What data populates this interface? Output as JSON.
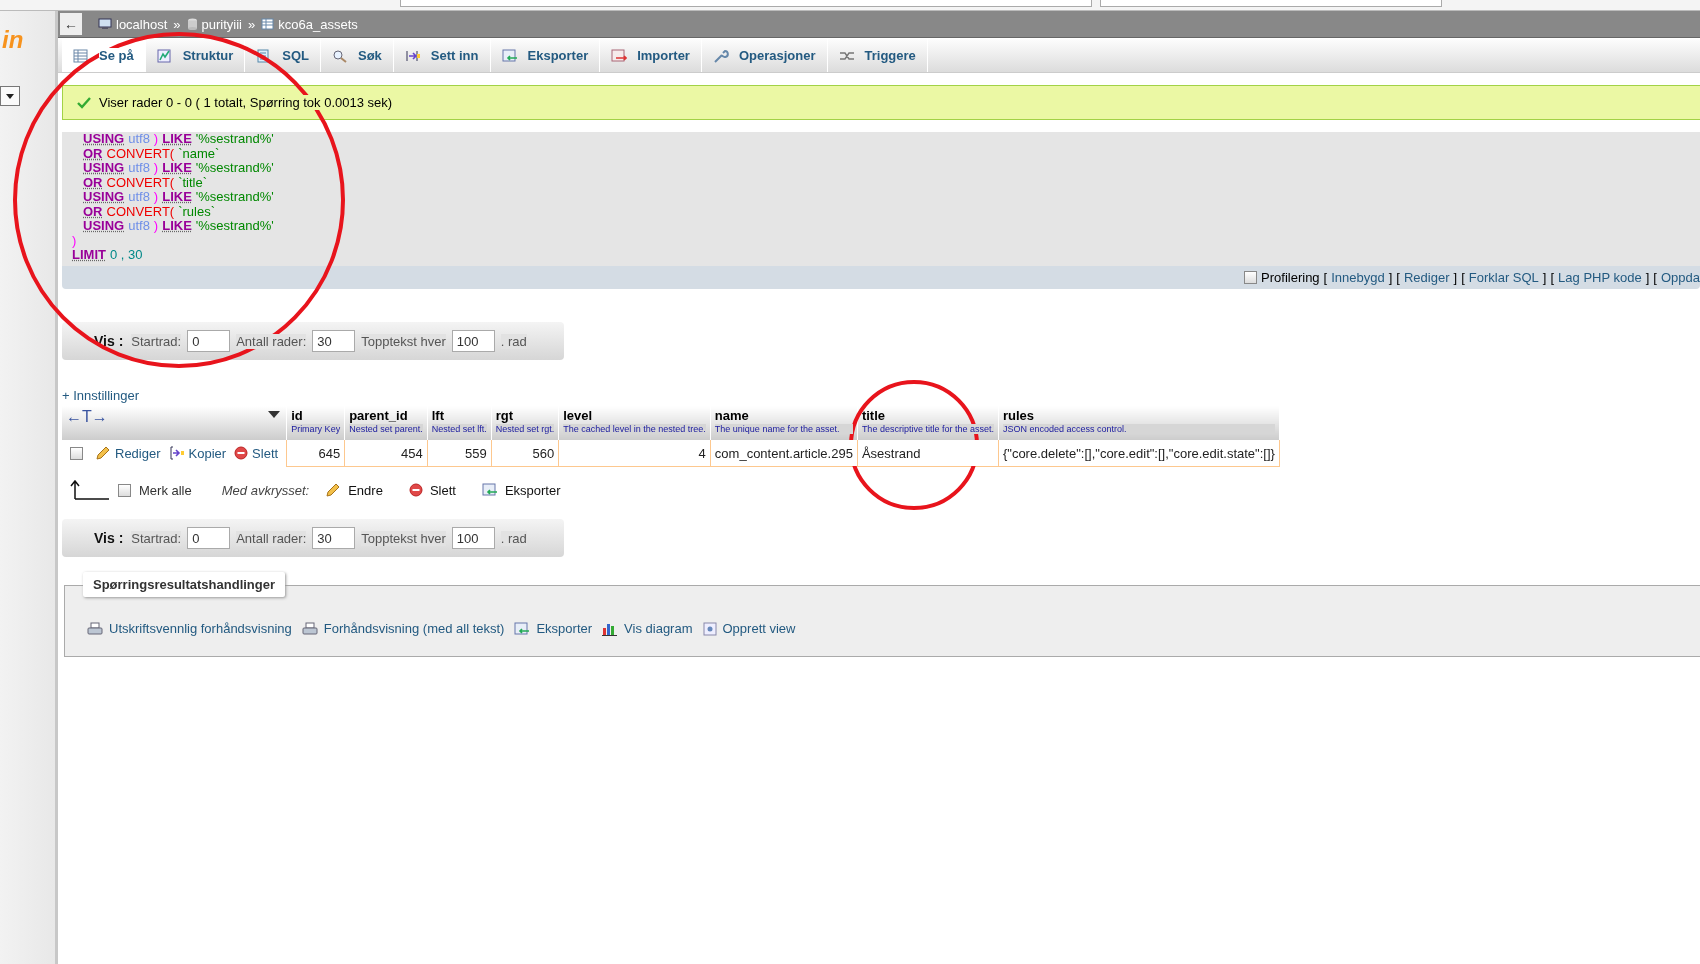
{
  "logo": {
    "text": "in"
  },
  "breadcrumb": [
    {
      "kind": "server",
      "text": "localhost",
      "sep": "»"
    },
    {
      "kind": "database",
      "text": "purityiii",
      "sep": "»"
    },
    {
      "kind": "table",
      "text": "kco6a_assets"
    }
  ],
  "back_button": {
    "text": "←"
  },
  "tabs": [
    {
      "kind": "browse",
      "label": "Se på",
      "selected": true
    },
    {
      "kind": "structure",
      "label": "Struktur",
      "selected": false
    },
    {
      "kind": "sql",
      "label": "SQL",
      "selected": false
    },
    {
      "kind": "search",
      "label": "Søk",
      "selected": false
    },
    {
      "kind": "insert",
      "label": "Sett inn",
      "selected": false
    },
    {
      "kind": "export",
      "label": "Eksporter",
      "selected": false
    },
    {
      "kind": "import",
      "label": "Importer",
      "selected": false
    },
    {
      "kind": "operations",
      "label": "Operasjoner",
      "selected": false
    },
    {
      "kind": "triggers",
      "label": "Triggere",
      "selected": false
    }
  ],
  "message": {
    "text": "Viser rader 0 - 0 ( 1 totalt, Spørring tok 0.0013 sek)"
  },
  "sql_lines": [
    {
      "indent": true,
      "tokens": [
        {
          "kind": "keyword",
          "text": "USING"
        },
        {
          "kind": "charset",
          "text": "utf8"
        },
        {
          "kind": "paren",
          "text": ")"
        },
        {
          "kind": "keyword",
          "text": "LIKE"
        },
        {
          "kind": "string",
          "text": "'%sestrand%'"
        }
      ]
    },
    {
      "indent": true,
      "tokens": [
        {
          "kind": "keyword",
          "text": "OR"
        },
        {
          "kind": "function",
          "text": "CONVERT("
        },
        {
          "kind": "string",
          "text": "`name`"
        }
      ]
    },
    {
      "indent": true,
      "tokens": [
        {
          "kind": "keyword",
          "text": "USING"
        },
        {
          "kind": "charset",
          "text": "utf8"
        },
        {
          "kind": "paren",
          "text": ")"
        },
        {
          "kind": "keyword",
          "text": "LIKE"
        },
        {
          "kind": "string",
          "text": "'%sestrand%'"
        }
      ]
    },
    {
      "indent": true,
      "tokens": [
        {
          "kind": "keyword",
          "text": "OR"
        },
        {
          "kind": "function",
          "text": "CONVERT("
        },
        {
          "kind": "string",
          "text": "`title`"
        }
      ]
    },
    {
      "indent": true,
      "tokens": [
        {
          "kind": "keyword",
          "text": "USING"
        },
        {
          "kind": "charset",
          "text": "utf8"
        },
        {
          "kind": "paren",
          "text": ")"
        },
        {
          "kind": "keyword",
          "text": "LIKE"
        },
        {
          "kind": "string",
          "text": "'%sestrand%'"
        }
      ]
    },
    {
      "indent": true,
      "tokens": [
        {
          "kind": "keyword",
          "text": "OR"
        },
        {
          "kind": "function",
          "text": "CONVERT("
        },
        {
          "kind": "string",
          "text": "`rules`"
        }
      ]
    },
    {
      "indent": true,
      "tokens": [
        {
          "kind": "keyword",
          "text": "USING"
        },
        {
          "kind": "charset",
          "text": "utf8"
        },
        {
          "kind": "paren",
          "text": ")"
        },
        {
          "kind": "keyword",
          "text": "LIKE"
        },
        {
          "kind": "string",
          "text": "'%sestrand%'"
        }
      ]
    },
    {
      "indent": false,
      "tokens": [
        {
          "kind": "paren",
          "text": ")"
        }
      ]
    },
    {
      "indent": false,
      "tokens": [
        {
          "kind": "keyword",
          "text": "LIMIT"
        },
        {
          "kind": "number",
          "text": "0 , 30"
        }
      ]
    }
  ],
  "profiling": {
    "label": "Profilering",
    "checked": false,
    "links": [
      {
        "open": "[",
        "text": "Innebygd",
        "close": "]"
      },
      {
        "open": "[",
        "text": "Rediger",
        "close": "]"
      },
      {
        "open": "[",
        "text": "Forklar SQL",
        "close": "]"
      },
      {
        "open": "[",
        "text": "Lag PHP kode",
        "close": "]"
      },
      {
        "open": "[",
        "text": "Oppda"
      }
    ]
  },
  "navigation": [
    {
      "title": "Vis :",
      "start_label": "Startrad:",
      "start": "0",
      "rows_label": "Antall rader:",
      "rows": "30",
      "header_label": "Topptekst hver",
      "header": "100",
      "suffix": ". rad"
    },
    {
      "title": "Vis :",
      "start_label": "Startrad:",
      "start": "0",
      "rows_label": "Antall rader:",
      "rows": "30",
      "header_label": "Topptekst hver",
      "header": "100",
      "suffix": ". rad"
    }
  ],
  "settings_link": "+ Innstillinger",
  "table": {
    "arrows": "←T→",
    "columns": [
      {
        "name": "id",
        "comment": "Primary Key",
        "kind": "number"
      },
      {
        "name": "parent_id",
        "comment": "Nested set parent.",
        "kind": "number"
      },
      {
        "name": "lft",
        "comment": "Nested set lft.",
        "kind": "number"
      },
      {
        "name": "rgt",
        "comment": "Nested set rgt.",
        "kind": "number"
      },
      {
        "name": "level",
        "comment": "The cached level in the nested tree.",
        "kind": "number"
      },
      {
        "name": "name",
        "comment": "The unique name for the asset.",
        "kind": "text"
      },
      {
        "name": "title",
        "comment": "The descriptive title for the asset.",
        "kind": "text"
      },
      {
        "name": "rules",
        "comment": "JSON encoded access control.",
        "kind": "text"
      }
    ],
    "rows": [
      {
        "checked": false,
        "actions": [
          "Rediger",
          "Kopier",
          "Slett"
        ],
        "cells": [
          "645",
          "454",
          "559",
          "560",
          "4",
          "com_content.article.295",
          "Åsestrand",
          "{\"core.delete\":[],\"core.edit\":[],\"core.edit.state\":[]}"
        ]
      }
    ]
  },
  "bulk": {
    "select_all": "Merk alle",
    "checked": false,
    "with_selected": "Med avkrysset:",
    "actions": [
      {
        "kind": "edit",
        "text": "Endre"
      },
      {
        "kind": "delete",
        "text": "Slett"
      },
      {
        "kind": "export",
        "text": "Eksporter"
      }
    ]
  },
  "result_actions": {
    "legend": "Spørringsresultatshandlinger",
    "links": [
      {
        "kind": "print",
        "text": "Utskriftsvennlig forhåndsvisning"
      },
      {
        "kind": "print",
        "text": "Forhåndsvisning (med all tekst)"
      },
      {
        "kind": "export",
        "text": "Eksporter"
      },
      {
        "kind": "chart",
        "text": "Vis diagram"
      },
      {
        "kind": "view",
        "text": "Opprett view"
      }
    ]
  },
  "annotations": [
    {
      "kind": "circle"
    },
    {
      "kind": "circle"
    }
  ]
}
